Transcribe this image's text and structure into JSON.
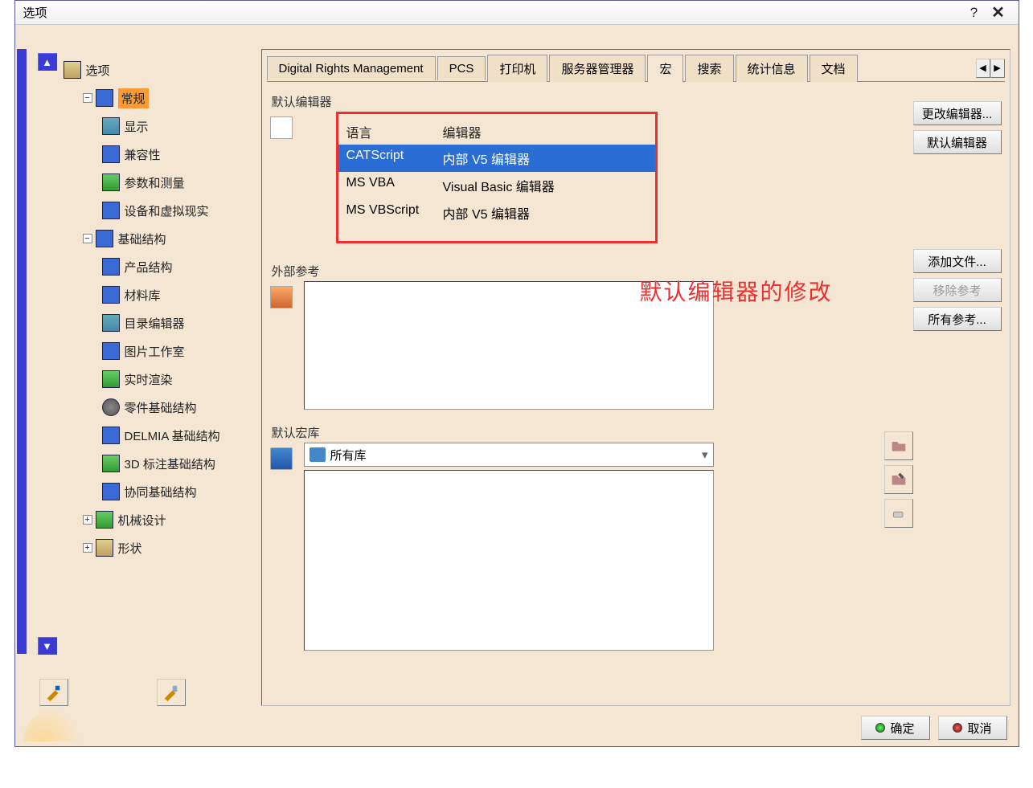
{
  "title": "选项",
  "tree": {
    "root": "选项",
    "general": "常规",
    "display": "显示",
    "compat": "兼容性",
    "params": "参数和测量",
    "devices": "设备和虚拟现实",
    "infra": "基础结构",
    "product": "产品结构",
    "material": "材料库",
    "catalog": "目录编辑器",
    "photo": "图片工作室",
    "render": "实时渲染",
    "partinfra": "零件基础结构",
    "delmia": "DELMIA 基础结构",
    "annot3d": "3D 标注基础结构",
    "collab": "协同基础结构",
    "mechdesign": "机械设计",
    "shape": "形状"
  },
  "tabs": {
    "drm": "Digital Rights Management",
    "pcs": "PCS",
    "printer": "打印机",
    "server": "服务器管理器",
    "macro": "宏",
    "search": "搜索",
    "stats": "统计信息",
    "doc": "文档"
  },
  "groups": {
    "editor": "默认编辑器",
    "extref": "外部参考",
    "macrolib": "默认宏库"
  },
  "editor_table": {
    "col_lang": "语言",
    "col_editor": "编辑器",
    "rows": [
      {
        "lang": "CATScript",
        "editor": "内部 V5 编辑器",
        "selected": true
      },
      {
        "lang": "MS VBA",
        "editor": "Visual Basic 编辑器",
        "selected": false
      },
      {
        "lang": "MS VBScript",
        "editor": "内部 V5 编辑器",
        "selected": false
      }
    ]
  },
  "buttons": {
    "change_editor": "更改编辑器...",
    "default_editor": "默认编辑器",
    "add_file": "添加文件...",
    "remove_ref": "移除参考",
    "all_ref": "所有参考...",
    "ok": "确定",
    "cancel": "取消"
  },
  "macro": {
    "selected": "所有库"
  },
  "annotation": "默认编辑器的修改"
}
